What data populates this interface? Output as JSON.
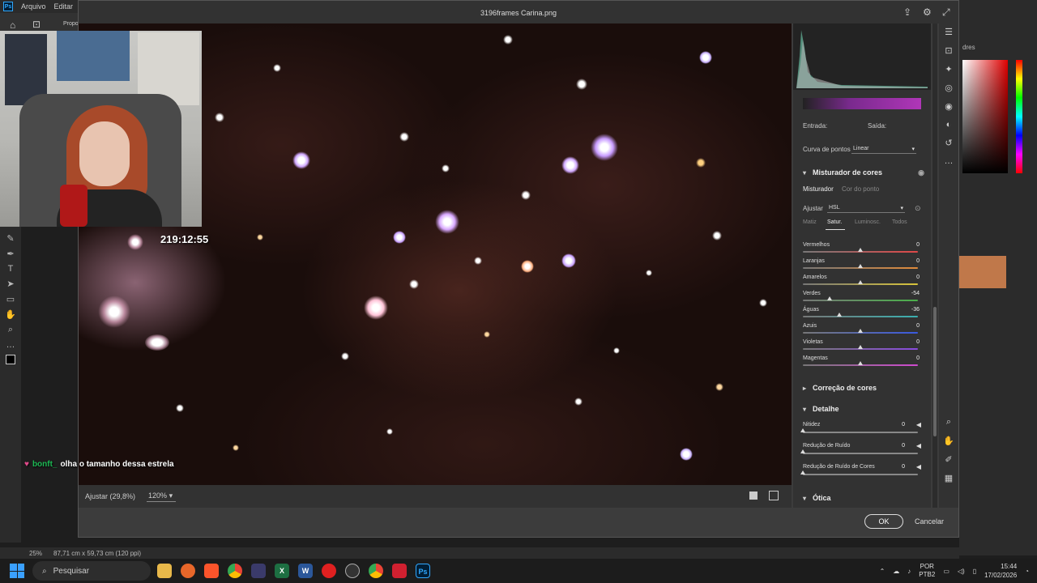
{
  "ps": {
    "logo": "Ps",
    "menu": [
      "Arquivo",
      "Editar",
      "Im"
    ],
    "options_label": "Propo",
    "tools": [
      "home-icon",
      "crop-icon",
      "brush-icon",
      "pen-icon",
      "type-icon",
      "select-icon",
      "rectangle-icon",
      "hand-icon",
      "zoom-icon",
      "more-icon"
    ],
    "status_zoom": "25%",
    "status_info": "87,71 cm x 59,73 cm (120 ppi)",
    "right_text": "dres"
  },
  "dialog": {
    "title": "3196frames Carina.png",
    "fit_label": "Ajustar (29,8%)",
    "zoom_value": "120%",
    "ok_label": "OK",
    "cancel_label": "Cancelar"
  },
  "panel": {
    "entrada_label": "Entrada:",
    "saida_label": "Saída:",
    "curve_type_label": "Curva de pontos",
    "curve_type_value": "Linear",
    "mixer_title": "Misturador de cores",
    "mixer_tab_active": "Misturador",
    "mixer_tab_other": "Cor do ponto",
    "adjust_label": "Ajustar",
    "adjust_value": "HSL",
    "subtabs": [
      "Matiz",
      "Satur.",
      "Luminosc.",
      "Todos"
    ],
    "active_subtab": "Satur.",
    "sliders": [
      {
        "label": "Vermelhos",
        "value": "0"
      },
      {
        "label": "Laranjas",
        "value": "0"
      },
      {
        "label": "Amarelos",
        "value": "0"
      },
      {
        "label": "Verdes",
        "value": "-54"
      },
      {
        "label": "Águas",
        "value": "-36"
      },
      {
        "label": "Azuis",
        "value": "0"
      },
      {
        "label": "Violetas",
        "value": "0"
      },
      {
        "label": "Magentas",
        "value": "0"
      }
    ],
    "correction_title": "Correção de cores",
    "detail_title": "Detalhe",
    "detail_sliders": [
      {
        "label": "Nitidez",
        "value": "0"
      },
      {
        "label": "Redução de Ruído",
        "value": "0"
      },
      {
        "label": "Redução de Ruído de Cores",
        "value": "0"
      }
    ],
    "optics_title": "Ótica",
    "colors": {
      "Vermelhos": "#e04848",
      "Laranjas": "#e08a3a",
      "Amarelos": "#d8c43a",
      "Verdes": "#4ab04a",
      "Águas": "#3ab0b0",
      "Azuis": "#3a5ae0",
      "Violetas": "#8a4ae0",
      "Magentas": "#d04ad0"
    }
  },
  "stream": {
    "timer": "219:12:55",
    "chat_user": "bonft_",
    "chat_message": "olha o tamanho dessa estrela"
  },
  "taskbar": {
    "search_placeholder": "Pesquisar",
    "lang_top": "POR",
    "lang_bottom": "PTB2",
    "time": "15:44",
    "date": "17/02/2026"
  }
}
